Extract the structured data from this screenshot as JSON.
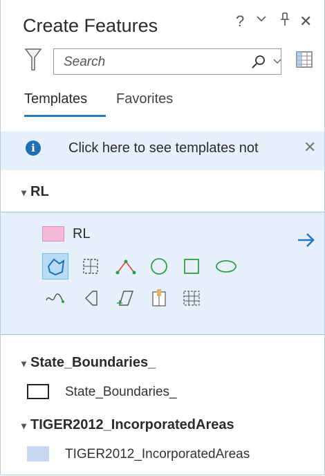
{
  "window": {
    "title": "Create Features",
    "help_label": "?",
    "menu_label": "⌄",
    "pin_label": "ᐩ",
    "close_label": "✕"
  },
  "search": {
    "placeholder": "Search"
  },
  "tabs": [
    {
      "label": "Templates"
    },
    {
      "label": "Favorites"
    }
  ],
  "info_bar": {
    "text": "Click here to see templates not",
    "close_label": "✕"
  },
  "groups": [
    {
      "name": "RL",
      "items": [
        {
          "label": "RL",
          "color": "#f6b8d8"
        }
      ]
    },
    {
      "name": "State_Boundaries_",
      "items": [
        {
          "label": "State_Boundaries_",
          "color": "#ffffff"
        }
      ]
    },
    {
      "name": "TIGER2012_IncorporatedAreas",
      "items": [
        {
          "label": "TIGER2012_IncorporatedAreas",
          "color": "#c9d7f2"
        }
      ]
    }
  ],
  "tool_icons": [
    "autocomplete-polygon-icon",
    "stretch-points-icon",
    "polyline-icon",
    "circle-icon",
    "rectangle-icon",
    "ellipse-icon",
    "freehand-icon",
    "right-angle-icon",
    "triangle-icon",
    "split-icon",
    "table-icon"
  ],
  "colors": {
    "accent": "#1f7ac8",
    "selection_bg": "#e6f0fa"
  }
}
